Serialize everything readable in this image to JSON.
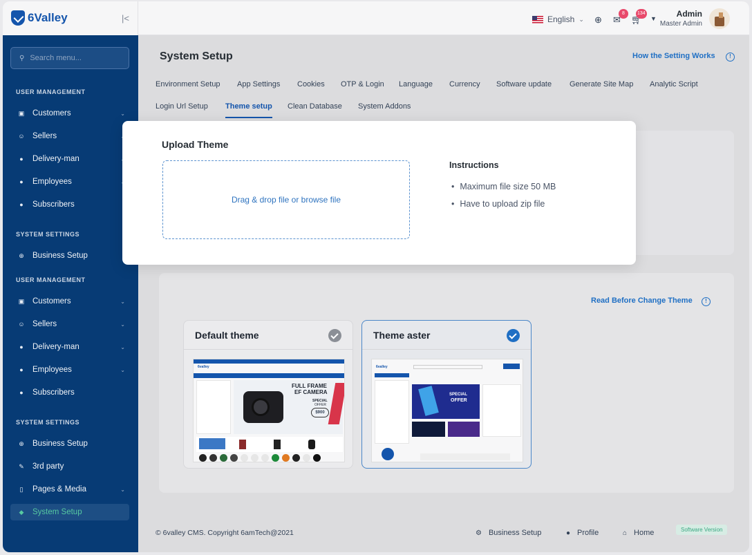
{
  "header": {
    "brand": "6Valley",
    "collapse_icon": "collapse-icon",
    "language": "English",
    "message_badge": "8",
    "cart_badge": "134",
    "user_name": "Admin",
    "user_role": "Master Admin"
  },
  "sidebar": {
    "search_placeholder": "Search menu...",
    "sections": [
      {
        "title": "USER MANAGEMENT",
        "items": [
          {
            "label": "Customers",
            "icon": "customers-icon",
            "chevron": true
          },
          {
            "label": "Sellers",
            "icon": "sellers-icon",
            "chevron": true
          },
          {
            "label": "Delivery-man",
            "icon": "delivery-icon",
            "chevron": true
          },
          {
            "label": "Employees",
            "icon": "employees-icon",
            "chevron": true
          },
          {
            "label": "Subscribers",
            "icon": "subscribers-icon",
            "chevron": false
          }
        ]
      },
      {
        "title": "SYSTEM SETTINGS",
        "items": [
          {
            "label": "Business Setup",
            "icon": "globe-icon",
            "chevron": false
          }
        ]
      },
      {
        "title": "USER MANAGEMENT",
        "items": [
          {
            "label": "Customers",
            "icon": "customers-icon",
            "chevron": true
          },
          {
            "label": "Sellers",
            "icon": "sellers-icon",
            "chevron": true
          },
          {
            "label": "Delivery-man",
            "icon": "delivery-icon",
            "chevron": true
          },
          {
            "label": "Employees",
            "icon": "employees-icon",
            "chevron": true
          },
          {
            "label": "Subscribers",
            "icon": "subscribers-icon",
            "chevron": false
          }
        ]
      },
      {
        "title": "SYSTEM SETTINGS",
        "items": [
          {
            "label": "Business Setup",
            "icon": "globe-icon",
            "chevron": false
          },
          {
            "label": "3rd party",
            "icon": "tools-icon",
            "chevron": false
          },
          {
            "label": "Pages & Media",
            "icon": "pages-icon",
            "chevron": true
          },
          {
            "label": "System Setup",
            "icon": "system-icon",
            "chevron": false,
            "active": true
          }
        ]
      }
    ]
  },
  "page": {
    "title": "System Setup",
    "how_link": "How the Setting Works",
    "tabs_row1": [
      "Environment Setup",
      "App Settings",
      "Cookies",
      "OTP & Login",
      "Language",
      "Currency",
      "Software update",
      "Generate Site Map",
      "Analytic Script"
    ],
    "tabs_row2": [
      "Login Url Setup",
      "Theme setup",
      "Clean Database",
      "System Addons"
    ],
    "active_tab": "Theme setup"
  },
  "theme_section": {
    "read_link": "Read Before Change Theme",
    "themes": [
      {
        "name": "Default theme",
        "selected": false
      },
      {
        "name": "Theme aster",
        "selected": true
      }
    ],
    "default_preview": {
      "logo": "6valley",
      "headline_1": "FULL FRAME",
      "headline_2": "EF CAMERA",
      "special": "SPECIAL",
      "offer": "OFFER",
      "price": "$900"
    },
    "aster_preview": {
      "logo": "6valley",
      "special": "SPECIAL",
      "offer": "OFFER"
    }
  },
  "upload_modal": {
    "title": "Upload Theme",
    "dropzone_text": "Drag & drop file or browse file",
    "instructions_title": "Instructions",
    "instructions": [
      "Maximum file size 50 MB",
      "Have to upload zip file"
    ]
  },
  "footer": {
    "copyright": "© 6valley CMS. Copyright 6amTech@2021",
    "links": [
      "Business Setup",
      "Profile",
      "Home"
    ],
    "software_version": "Software Version"
  },
  "colors": {
    "sidebar_bg": "#073b75",
    "brand_blue": "#1455ac",
    "link_blue": "#1f6fc4",
    "active_green": "#57c9a1"
  }
}
